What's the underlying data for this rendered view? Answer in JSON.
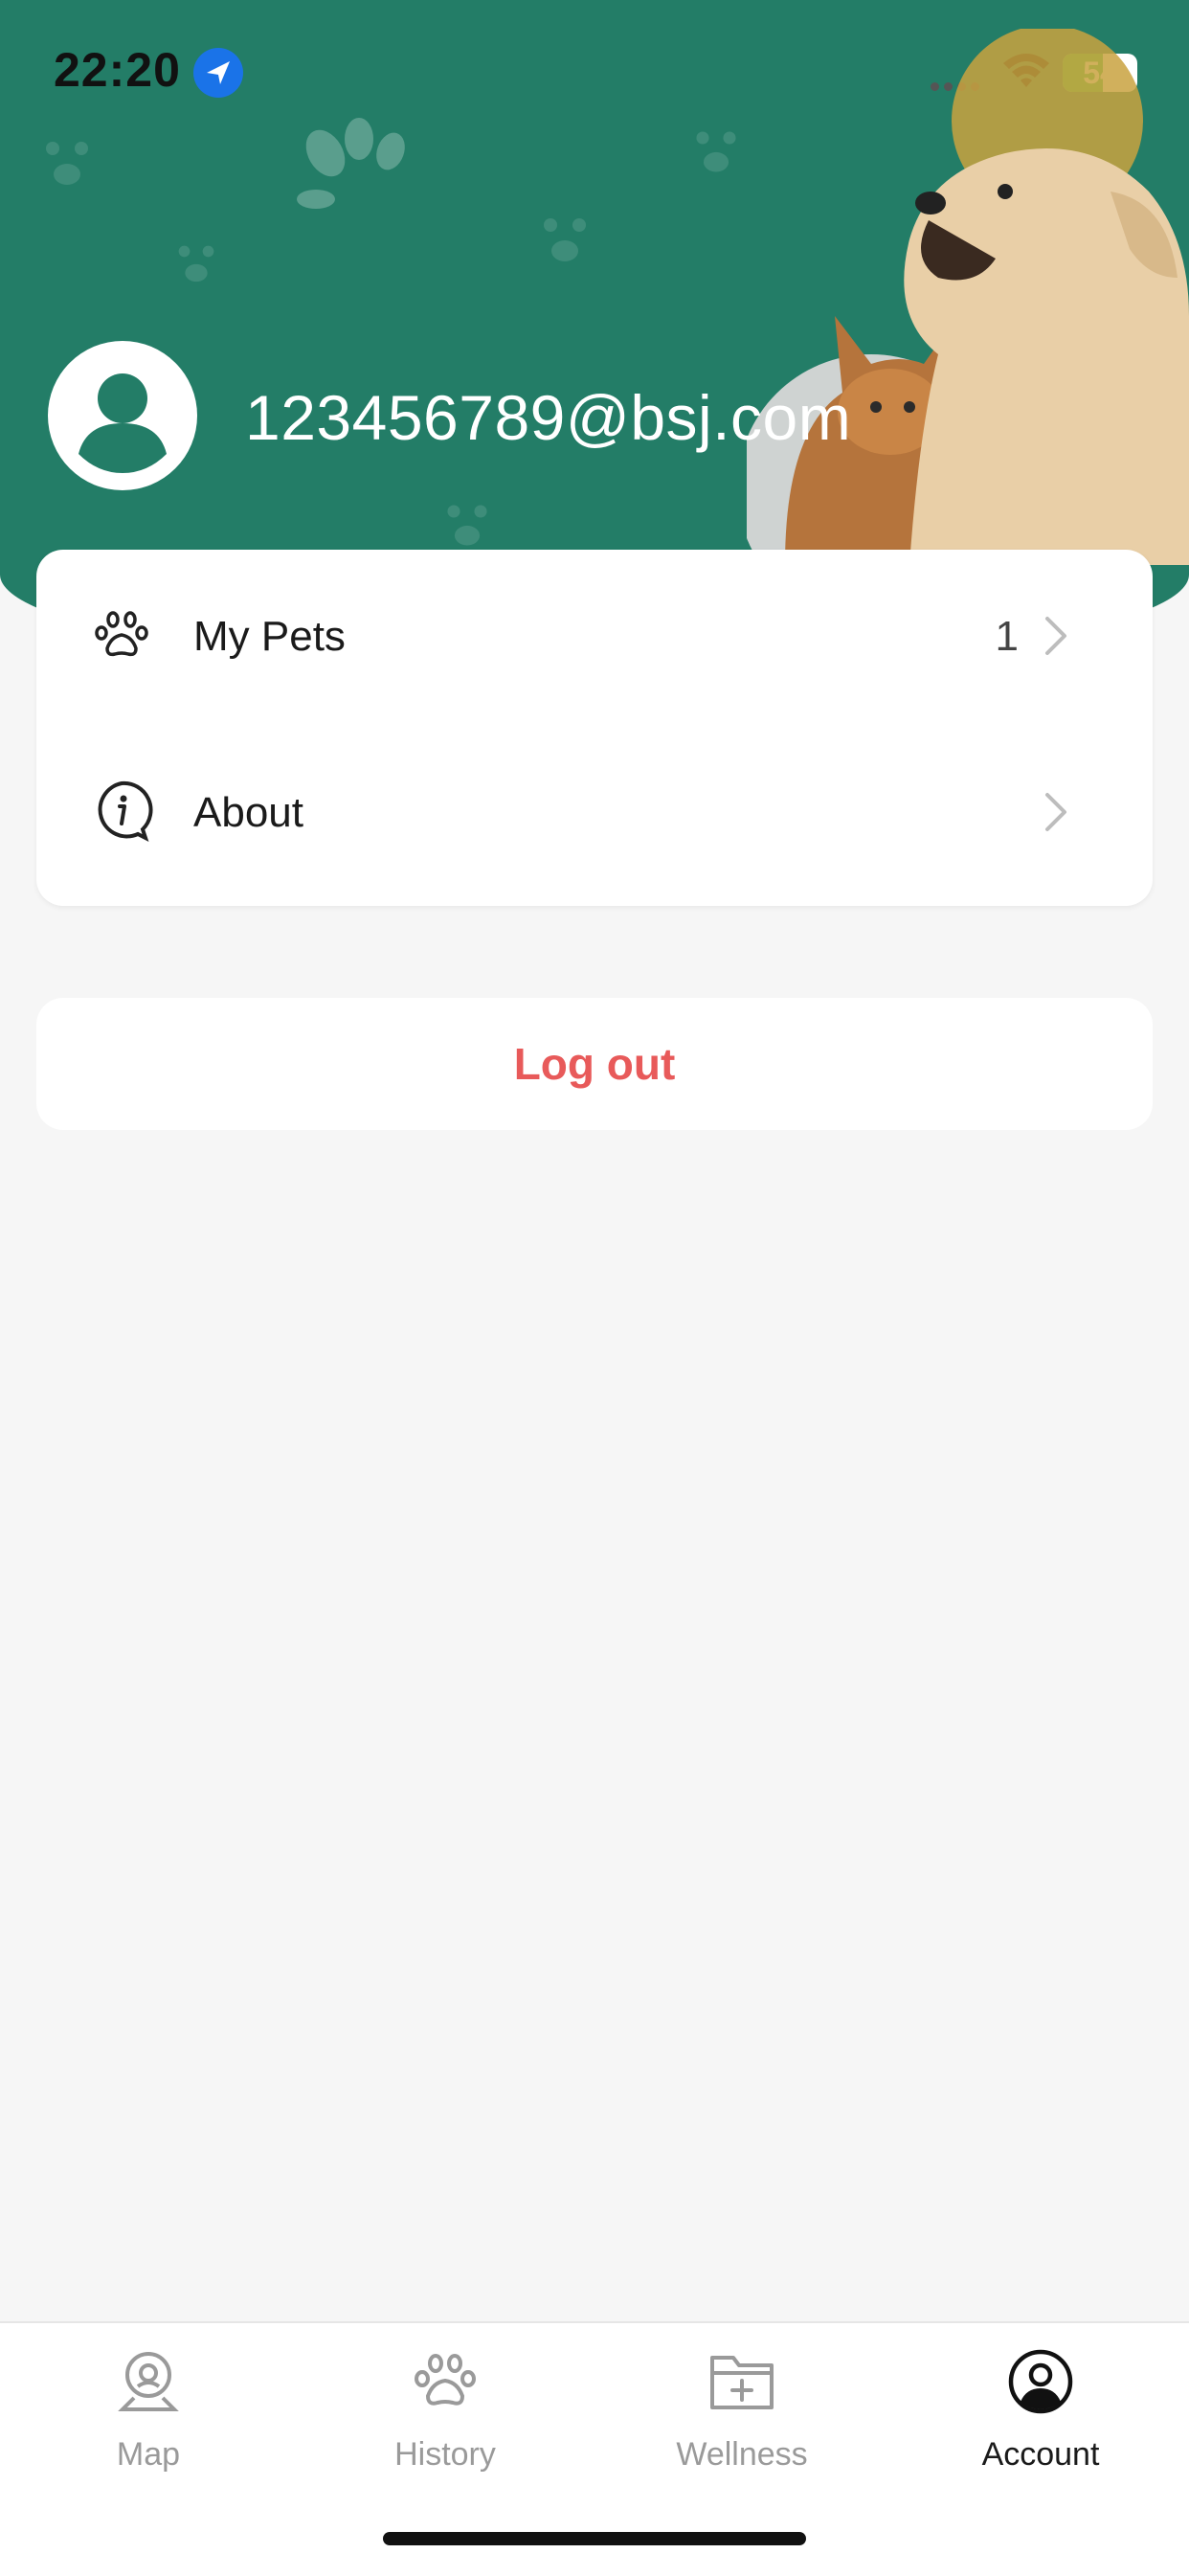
{
  "status_bar": {
    "time": "22:20",
    "battery_percent": "54"
  },
  "profile": {
    "email": "123456789@bsj.com"
  },
  "menu": {
    "items": [
      {
        "label": "My Pets",
        "count": "1",
        "icon": "paw-icon"
      },
      {
        "label": "About",
        "count": "",
        "icon": "info-icon"
      }
    ]
  },
  "logout": {
    "label": "Log out"
  },
  "tabs": [
    {
      "label": "Map",
      "icon": "map-pin-icon",
      "active": false
    },
    {
      "label": "History",
      "icon": "paw-icon",
      "active": false
    },
    {
      "label": "Wellness",
      "icon": "folder-plus-icon",
      "active": false
    },
    {
      "label": "Account",
      "icon": "user-circle-icon",
      "active": true
    }
  ],
  "colors": {
    "header_green": "#237d67",
    "logout_red": "#e85a5a",
    "background": "#f6f6f6",
    "battery_green": "#34c759"
  }
}
